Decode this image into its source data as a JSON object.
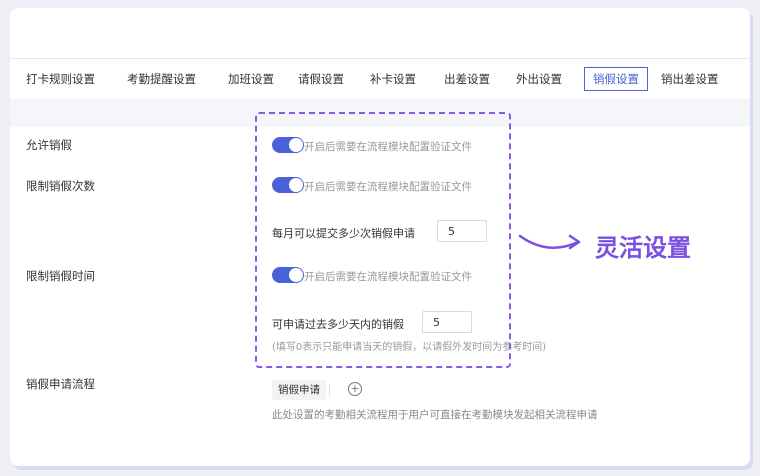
{
  "tabs": [
    {
      "label": "打卡规则设置"
    },
    {
      "label": "考勤提醒设置"
    },
    {
      "label": "加班设置"
    },
    {
      "label": "请假设置"
    },
    {
      "label": "补卡设置"
    },
    {
      "label": "出差设置"
    },
    {
      "label": "外出设置"
    },
    {
      "label": "销假设置",
      "active": true
    },
    {
      "label": "销出差设置"
    }
  ],
  "settings": {
    "allow_cancel": {
      "label": "允许销假",
      "hint": "开启后需要在流程模块配置验证文件",
      "enabled": true
    },
    "limit_count": {
      "label": "限制销假次数",
      "hint": "开启后需要在流程模块配置验证文件",
      "enabled": true,
      "monthly_label": "每月可以提交多少次销假申请",
      "monthly_value": "5"
    },
    "limit_time": {
      "label": "限制销假时间",
      "hint": "开启后需要在流程模块配置验证文件",
      "enabled": true,
      "days_label": "可申请过去多少天内的销假",
      "days_value": "5",
      "days_note": "(填写0表示只能申请当天的销假，以请假外发时间为参考时间)"
    },
    "flow": {
      "label": "销假申请流程",
      "tag": "销假申请",
      "add_symbol": "+",
      "note": "此处设置的考勤相关流程用于用户可直接在考勤模块发起相关流程申请"
    }
  },
  "callout": {
    "text": "灵活设置",
    "color": "#7b4fe0"
  },
  "colors": {
    "accent": "#4a62d8",
    "highlight": "#8b59e8"
  }
}
